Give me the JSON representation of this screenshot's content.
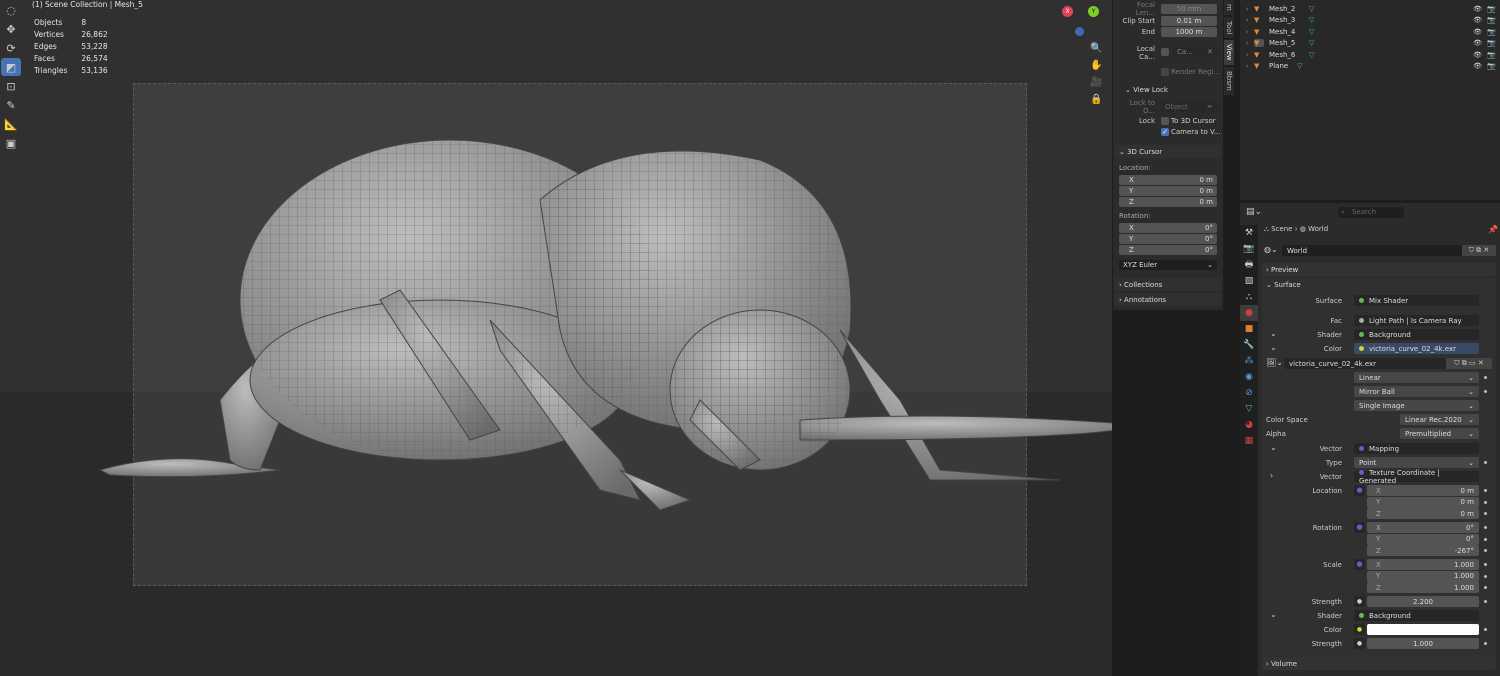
{
  "viewport": {
    "title": "(1) Scene Collection | Mesh_5",
    "stats": [
      {
        "label": "Objects",
        "value": "8"
      },
      {
        "label": "Vertices",
        "value": "26,862"
      },
      {
        "label": "Edges",
        "value": "53,228"
      },
      {
        "label": "Faces",
        "value": "26,574"
      },
      {
        "label": "Triangles",
        "value": "53,136"
      }
    ],
    "gizmo": {
      "x": "X",
      "y": "Y"
    }
  },
  "npanel": {
    "focal_label": "Focal Len...",
    "focal_value": "50 mm",
    "clip_start_label": "Clip Start",
    "clip_start_value": "0.01 m",
    "clip_end_label": "End",
    "clip_end_value": "1000 m",
    "local_cam_label": "Local Ca...",
    "local_cam_value": "Ca...",
    "render_region": "Render Regi...",
    "view_lock": "View Lock",
    "lock_to_label": "Lock to O...",
    "lock_to_value": "Object",
    "lock_label": "Lock",
    "to_cursor": "To 3D Cursor",
    "camera_to_view": "Camera to V...",
    "cursor_header": "3D Cursor",
    "location_label": "Location:",
    "loc": [
      {
        "axis": "X",
        "value": "0 m"
      },
      {
        "axis": "Y",
        "value": "0 m"
      },
      {
        "axis": "Z",
        "value": "0 m"
      }
    ],
    "rotation_label": "Rotation:",
    "rot": [
      {
        "axis": "X",
        "value": "0°"
      },
      {
        "axis": "Y",
        "value": "0°"
      },
      {
        "axis": "Z",
        "value": "0°"
      }
    ],
    "rotation_mode": "XYZ Euler",
    "collections": "Collections",
    "annotations": "Annotations"
  },
  "ntabs": [
    "m",
    "Tool",
    "View",
    "Bbsm"
  ],
  "outliner": {
    "items": [
      "Mesh_2",
      "Mesh_3",
      "Mesh_4",
      "Mesh_5",
      "Mesh_6",
      "Plane"
    ]
  },
  "properties": {
    "search_placeholder": "Search",
    "breadcrumb_scene": "Scene",
    "breadcrumb_world": "World",
    "world_name": "World",
    "preview": "Preview",
    "surface_header": "Surface",
    "surface_label": "Surface",
    "surface_value": "Mix Shader",
    "fac_label": "Fac",
    "fac_value": "Light Path | Is Camera Ray",
    "shader_label": "Shader",
    "shader_value": "Background",
    "color_label": "Color",
    "color_value": "victoria_curve_02_4k.exr",
    "image_name": "victoria_curve_02_4k.exr",
    "interp": "Linear",
    "projection": "Mirror Ball",
    "source": "Single Image",
    "color_space_label": "Color Space",
    "color_space_value": "Linear Rec.2020",
    "alpha_label": "Alpha",
    "alpha_value": "Premultiplied",
    "vector_label": "Vector",
    "vector_value": "Mapping",
    "type_label": "Type",
    "type_value": "Point",
    "vector2_label": "Vector",
    "vector2_value": "Texture Coordinate | Generated",
    "location_label": "Location",
    "location": [
      {
        "axis": "X",
        "value": "0 m"
      },
      {
        "axis": "Y",
        "value": "0 m"
      },
      {
        "axis": "Z",
        "value": "0 m"
      }
    ],
    "rotation_label": "Rotation",
    "rotation": [
      {
        "axis": "X",
        "value": "0°"
      },
      {
        "axis": "Y",
        "value": "0°"
      },
      {
        "axis": "Z",
        "value": "-267°"
      }
    ],
    "scale_label": "Scale",
    "scale": [
      {
        "axis": "X",
        "value": "1.000"
      },
      {
        "axis": "Y",
        "value": "1.000"
      },
      {
        "axis": "Z",
        "value": "1.000"
      }
    ],
    "strength_label": "Strength",
    "strength_value": "2.200",
    "shader2_label": "Shader",
    "shader2_value": "Background",
    "color2_label": "Color",
    "color2_hex": "#ffffff",
    "strength2_label": "Strength",
    "strength2_value": "1.000",
    "volume": "Volume"
  }
}
